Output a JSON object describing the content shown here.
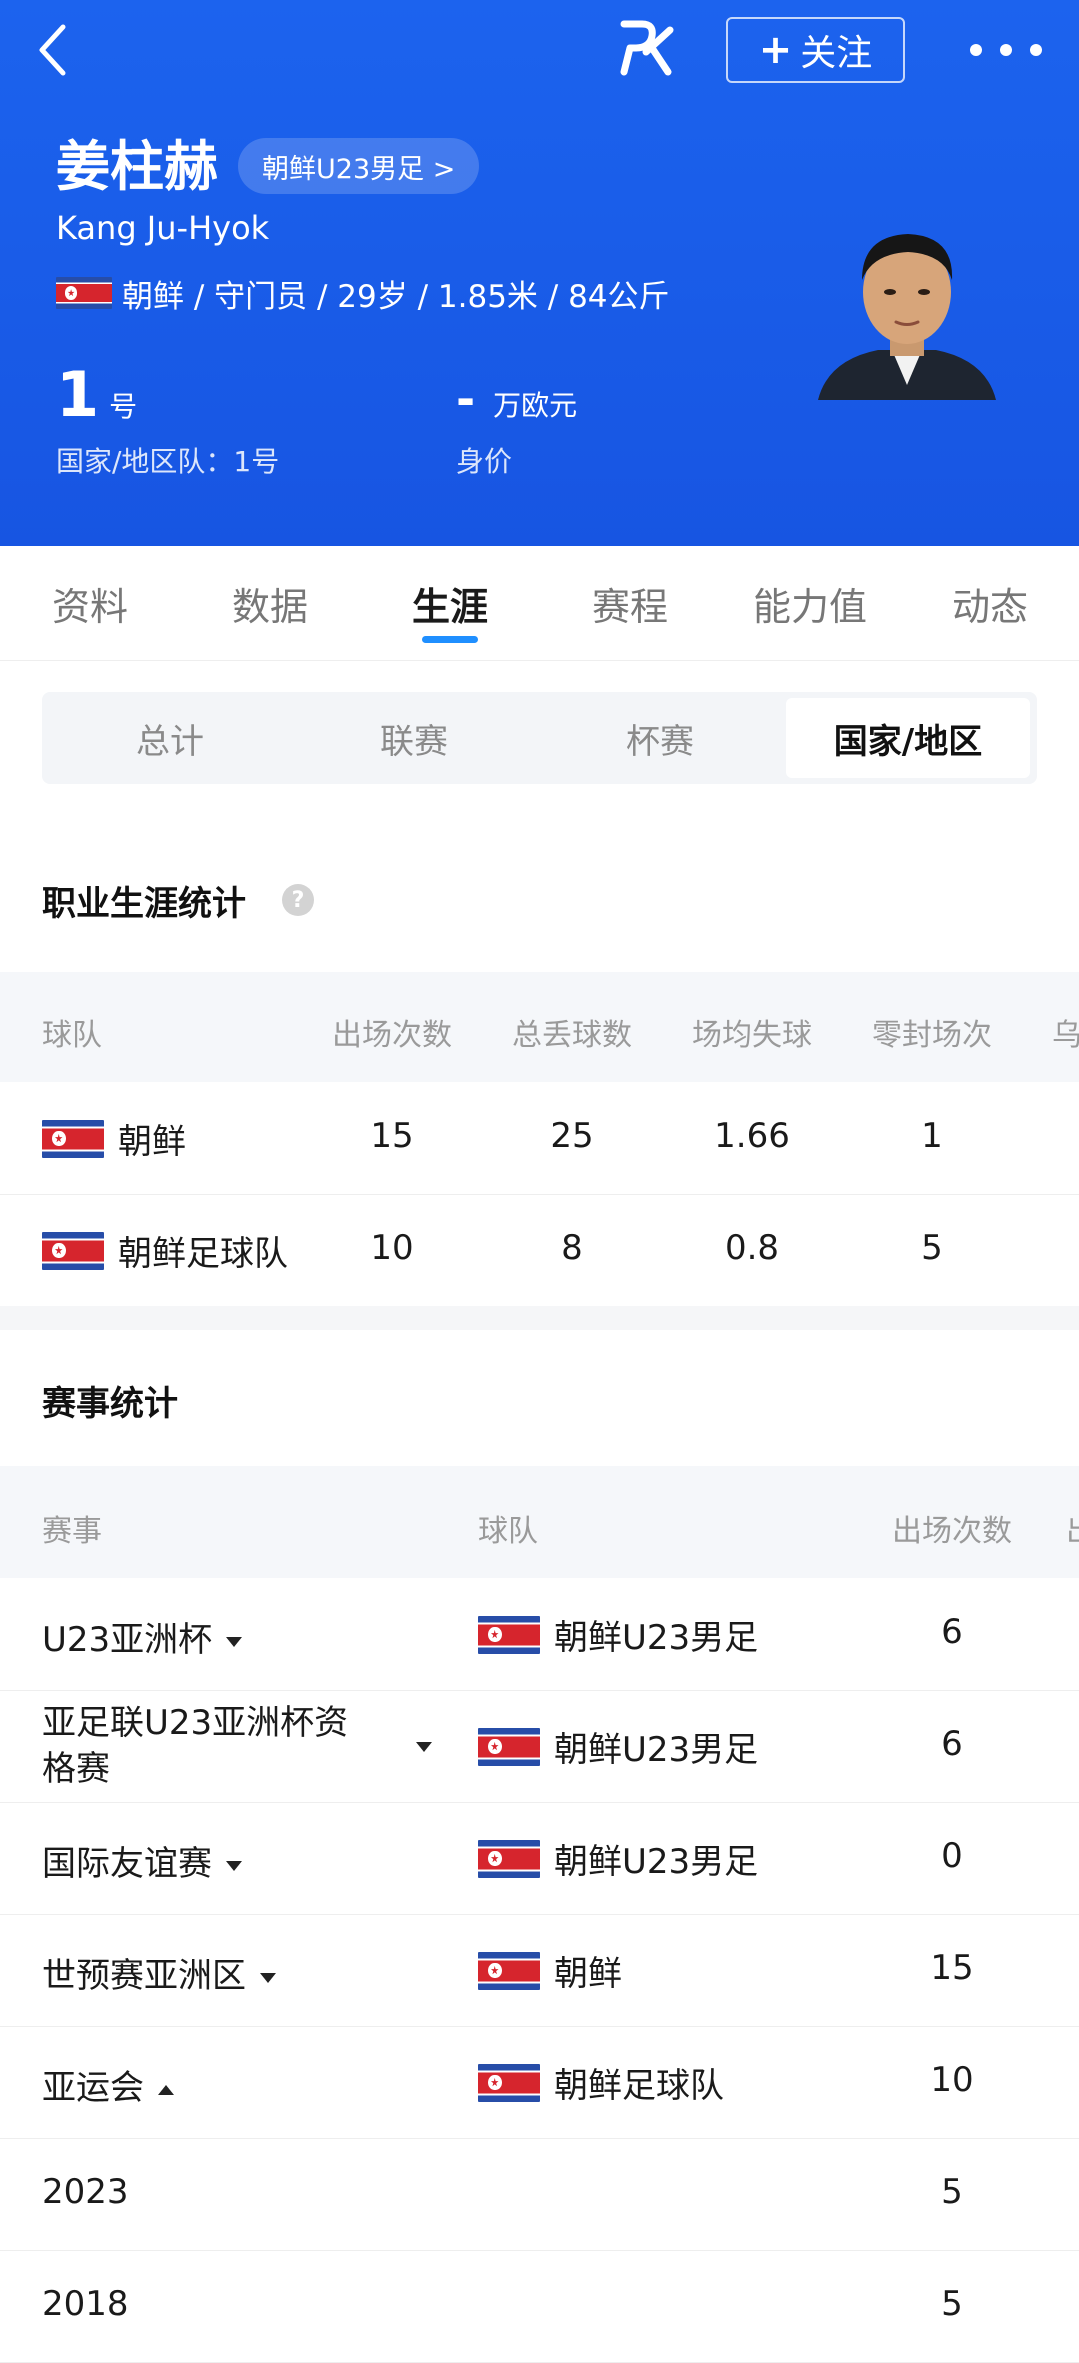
{
  "header": {
    "follow_label": "关注",
    "follow_plus": "+",
    "logo_text": "PK"
  },
  "player": {
    "name_cn": "姜柱赫",
    "name_en": "Kang Ju-Hyok",
    "team_chip": "朝鲜U23男足 >",
    "info": "朝鲜 / 守门员 / 29岁 / 1.85米 / 84公斤",
    "number": "1",
    "number_unit": "号",
    "number_label": "国家/地区队：1号",
    "value": "-",
    "value_unit": "万欧元",
    "value_label": "身价"
  },
  "tabs": [
    "资料",
    "数据",
    "生涯",
    "赛程",
    "能力值",
    "动态"
  ],
  "active_tab": "生涯",
  "segments": [
    "总计",
    "联赛",
    "杯赛",
    "国家/地区"
  ],
  "active_segment": "国家/地区",
  "career": {
    "title": "职业生涯统计",
    "help_icon": "?",
    "headers": [
      "球队",
      "出场次数",
      "总丢球数",
      "场均失球",
      "零封场次",
      "乌"
    ],
    "rows": [
      {
        "team": "朝鲜",
        "apps": "15",
        "conceded": "25",
        "avg": "1.66",
        "clean": "1"
      },
      {
        "team": "朝鲜足球队",
        "apps": "10",
        "conceded": "8",
        "avg": "0.8",
        "clean": "5"
      }
    ]
  },
  "competitions": {
    "title": "赛事统计",
    "headers": [
      "赛事",
      "球队",
      "出场次数",
      "出"
    ],
    "rows": [
      {
        "name": "U23亚洲杯",
        "caret": "down",
        "team": "朝鲜U23男足",
        "apps": "6"
      },
      {
        "name": "亚足联U23亚洲杯资格赛",
        "name_line1": "亚足联U23亚洲杯资",
        "name_line2": "格赛",
        "caret": "down",
        "team": "朝鲜U23男足",
        "apps": "6"
      },
      {
        "name": "国际友谊赛",
        "caret": "down",
        "team": "朝鲜U23男足",
        "apps": "0"
      },
      {
        "name": "世预赛亚洲区",
        "caret": "down",
        "team": "朝鲜",
        "apps": "15"
      },
      {
        "name": "亚运会",
        "caret": "up",
        "team": "朝鲜足球队",
        "apps": "10"
      },
      {
        "name": "2023",
        "caret": "",
        "team": "",
        "apps": "5"
      },
      {
        "name": "2018",
        "caret": "",
        "team": "",
        "apps": "5"
      }
    ]
  },
  "colors": {
    "hero": "#1c63ee",
    "accent": "#1f8fff",
    "flag_red": "#d6252d",
    "flag_blue": "#274da8"
  }
}
